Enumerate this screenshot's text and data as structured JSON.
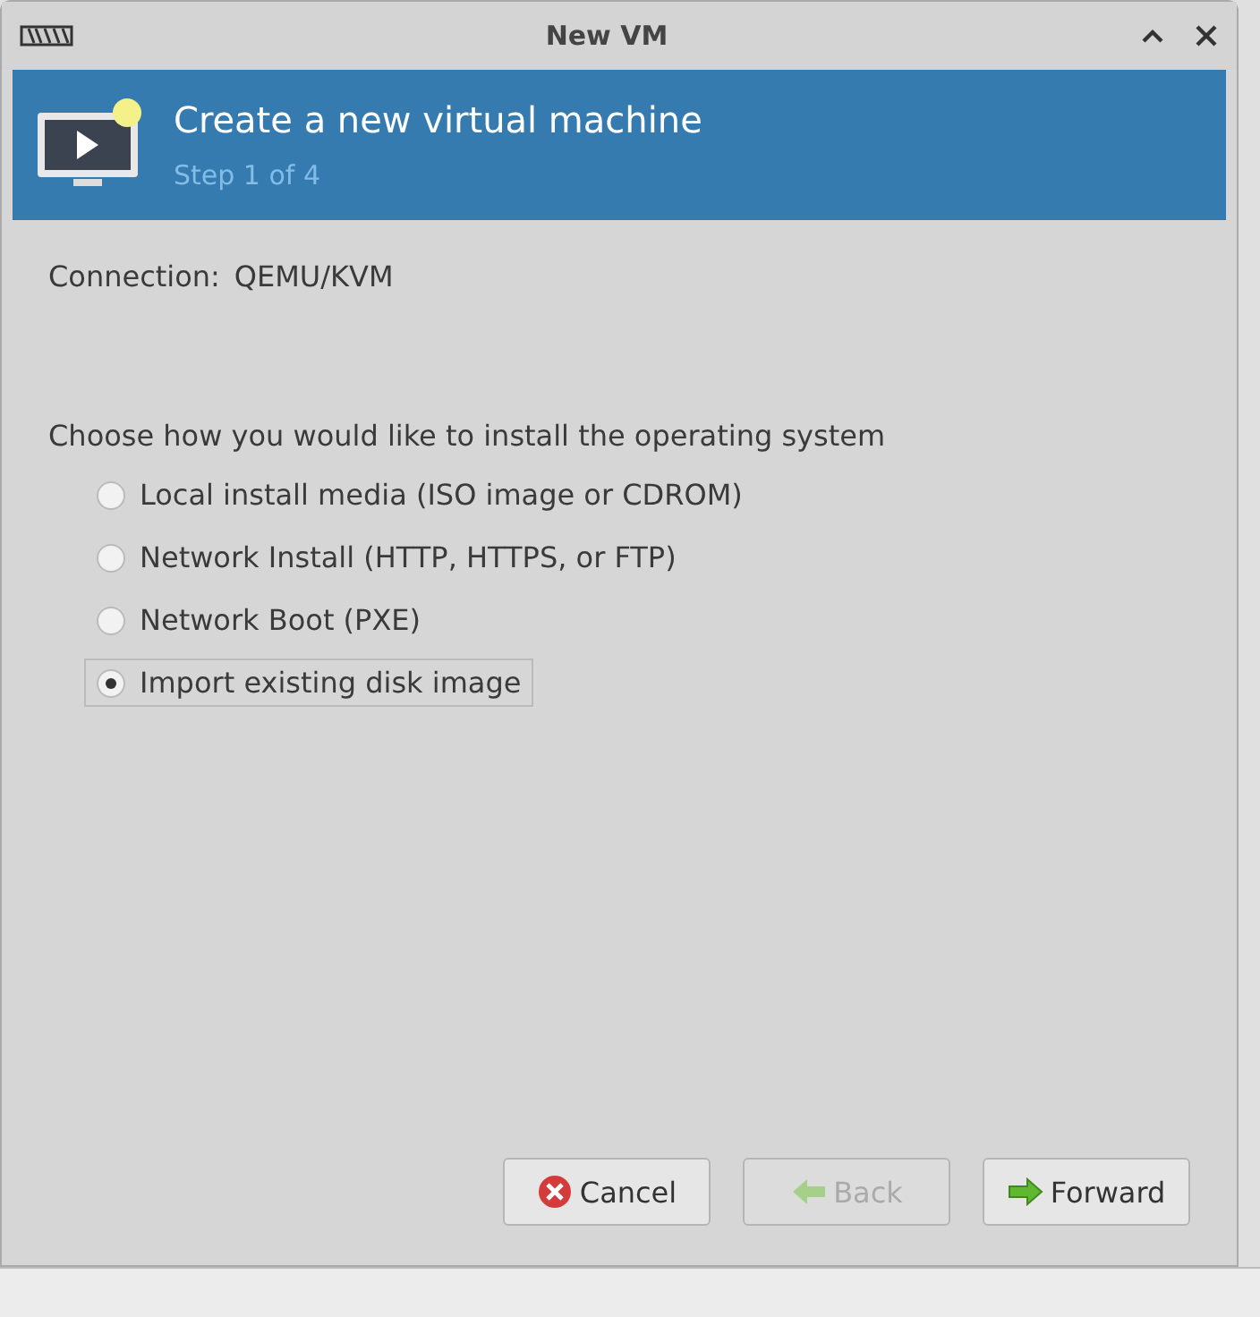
{
  "window": {
    "title": "New VM"
  },
  "header": {
    "title": "Create a new virtual machine",
    "step": "Step 1 of 4"
  },
  "connection": {
    "label": "Connection:",
    "value": "QEMU/KVM"
  },
  "install": {
    "prompt": "Choose how you would like to install the operating system",
    "options": [
      {
        "label": "Local install media (ISO image or CDROM)",
        "selected": false
      },
      {
        "label": "Network Install (HTTP, HTTPS, or FTP)",
        "selected": false
      },
      {
        "label": "Network Boot (PXE)",
        "selected": false
      },
      {
        "label": "Import existing disk image",
        "selected": true
      }
    ]
  },
  "buttons": [
    {
      "label": "Cancel",
      "kind": "cancel",
      "disabled": false
    },
    {
      "label": "Back",
      "kind": "back",
      "disabled": true
    },
    {
      "label": "Forward",
      "kind": "forward",
      "disabled": false
    }
  ]
}
